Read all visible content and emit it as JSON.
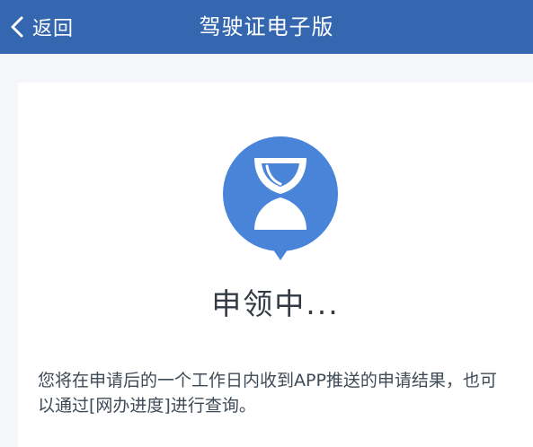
{
  "header": {
    "back_label": "返回",
    "title": "驾驶证电子版"
  },
  "status": {
    "icon": "hourglass-icon",
    "text": "申领中...",
    "description": "您将在申请后的一个工作日内收到APP推送的申请结果，也可以通过[网办进度]进行查询。"
  },
  "colors": {
    "header_bg": "#3566b0",
    "accent": "#4a84d8",
    "card_bg": "#ffffff",
    "page_bg": "#f4f6f9"
  }
}
